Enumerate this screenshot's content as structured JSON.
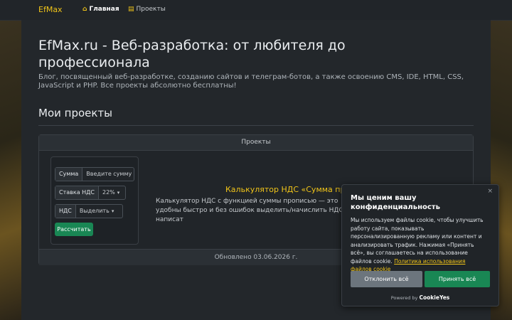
{
  "navbar": {
    "brand": "EfMax",
    "items": [
      {
        "icon": "home-icon",
        "label": "Главная"
      },
      {
        "icon": "projects-icon",
        "label": "Проекты"
      }
    ]
  },
  "header": {
    "title": "EfMax.ru - Веб-разработка: от любителя до профессионала",
    "subtitle": "Блог, посвященный веб-разработке, созданию сайтов и телеграм-ботов, а также освоению CMS, IDE, HTML, CSS, JavaScript и PHP. Все проекты абсолютно бесплатны!"
  },
  "section": {
    "title": "Мои проекты"
  },
  "card": {
    "header": "Проекты",
    "calculator": {
      "sum_label": "Сумма",
      "sum_placeholder": "Введите сумму",
      "rate_label": "Ставка НДС",
      "rate_value": "22%",
      "vat_label": "НДС",
      "vat_value": "Выделить",
      "submit_label": "Рассчитать"
    },
    "project_title": "Калькулятор НДС «Сумма проп",
    "project_description": "Калькулятор НДС с функцией суммы прописью — это удобны быстро и без ошибок выделить/начислить НДС и написат",
    "footer": "Обновлено 03.06.2026 г."
  },
  "cookie": {
    "close": "×",
    "title": "Мы ценим вашу конфиденциальность",
    "text": "Мы используем файлы cookie, чтобы улучшить работу сайта, показывать персонализированную рекламу или контент и анализировать трафик. Нажимая «Принять всё», вы соглашаетесь на использование файлов cookie.",
    "link": "Политика использования файлов cookie",
    "reject_label": "Отклонить всё",
    "accept_label": "Принять всё",
    "powered_by": "Powered by",
    "powered_brand": "CookieYes"
  },
  "colors": {
    "accent": "#f0c419",
    "success": "#198754",
    "secondary": "#6c757d",
    "background": "#23272b"
  }
}
